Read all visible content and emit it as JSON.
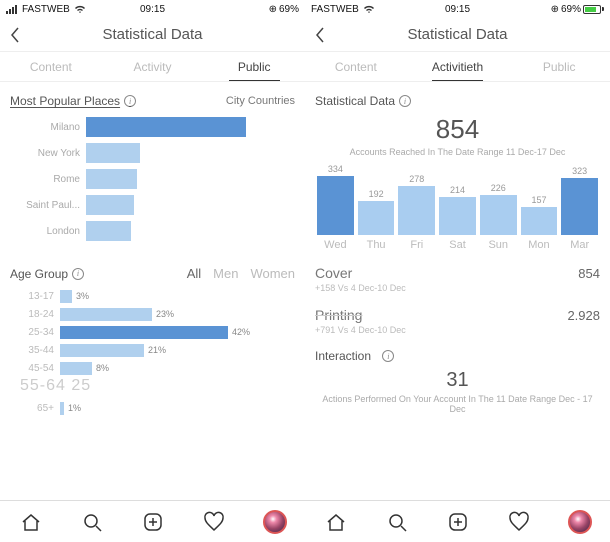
{
  "left": {
    "status": {
      "carrier": "FASTWEB",
      "time": "09:15",
      "battery": "69%",
      "battery_pct": 69
    },
    "title": "Statistical Data",
    "tabs": {
      "a": "Content",
      "b": "Activity",
      "c": "Public",
      "active": "c"
    },
    "places": {
      "title": "Most Popular Places",
      "right": "City Countries"
    },
    "age": {
      "title": "Age Group",
      "seg": {
        "all": "All",
        "men": "Men",
        "women": "Women"
      }
    },
    "age_55": "55-64 25"
  },
  "right": {
    "status": {
      "carrier": "FASTWEB",
      "time": "09:15",
      "battery": "69%",
      "battery_pct": 69
    },
    "title": "Statistical Data",
    "tabs": {
      "a": "Content",
      "b": "Activitieth",
      "c": "Public",
      "active": "b"
    },
    "stat_title": "Statistical Data",
    "reach_big": "854",
    "reach_sub": "Accounts Reached In The Date Range 11 Dec-17 Dec",
    "cover": {
      "name": "Cover",
      "val": "854",
      "sub": "+158 Vs 4 Dec-10 Dec"
    },
    "printing": {
      "name": "Printing",
      "val": "2.928",
      "sub": "+791 Vs 4 Dec-10 Dec"
    },
    "interaction": {
      "name": "Interaction",
      "big": "31",
      "sub": "Actions Performed On Your Account In The 11 Date Range Dec - 17 Dec"
    }
  },
  "chart_data": [
    {
      "type": "bar",
      "orientation": "horizontal",
      "title": "Most Popular Places",
      "categories": [
        "Milano",
        "New York",
        "Rome",
        "Saint Paul...",
        "London"
      ],
      "values": [
        100,
        34,
        32,
        30,
        28
      ],
      "highlight_index": 0,
      "unit": "relative"
    },
    {
      "type": "bar",
      "orientation": "horizontal",
      "title": "Age Group",
      "categories": [
        "13-17",
        "18-24",
        "25-34",
        "35-44",
        "45-54",
        "65+"
      ],
      "values": [
        3,
        23,
        42,
        21,
        8,
        1
      ],
      "highlight_index": 2,
      "unit": "%",
      "xlim": [
        0,
        50
      ]
    },
    {
      "type": "bar",
      "orientation": "vertical",
      "title": "Accounts Reached",
      "categories": [
        "Wed",
        "Thu",
        "Fri",
        "Sat",
        "Sun",
        "Mon",
        "Mar"
      ],
      "values": [
        334,
        192,
        278,
        214,
        226,
        157,
        323
      ],
      "ylim": [
        0,
        340
      ],
      "strong_indices": [
        0,
        6
      ]
    }
  ]
}
